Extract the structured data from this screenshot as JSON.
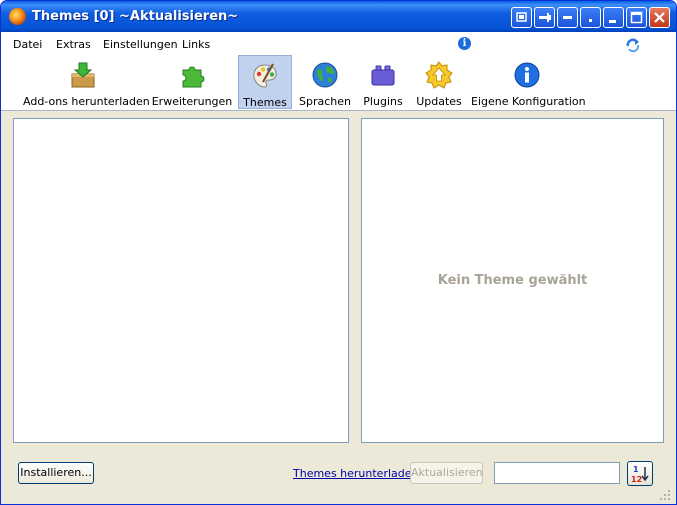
{
  "window": {
    "title": "Themes [0] ~Aktualisieren~",
    "controls": {
      "minimize": "–",
      "maximize": "□",
      "close": "×"
    }
  },
  "menu": [
    {
      "label": "Datei"
    },
    {
      "label": "Extras"
    },
    {
      "label": "Einstellungen"
    },
    {
      "label": "Links"
    }
  ],
  "toolbar": [
    {
      "label": "Add-ons herunterladen",
      "icon": "download-box-icon"
    },
    {
      "label": "Erweiterungen",
      "icon": "puzzle-piece-icon"
    },
    {
      "label": "Themes",
      "icon": "palette-icon",
      "selected": true
    },
    {
      "label": "Sprachen",
      "icon": "globe-icon"
    },
    {
      "label": "Plugins",
      "icon": "plugin-block-icon"
    },
    {
      "label": "Updates",
      "icon": "update-arrow-icon"
    },
    {
      "label": "Eigene Konfiguration",
      "icon": "info-icon"
    }
  ],
  "preview": {
    "empty_text": "Kein Theme gewählt"
  },
  "footer": {
    "install_label": "Installieren...",
    "download_link": "Themes herunterladen",
    "update_label": "Aktualisieren",
    "search_value": "",
    "sort_label": "1↓2"
  },
  "colors": {
    "titlebar": "#0653d6",
    "window_bg": "#ece9d8",
    "selected_tool": "#c1d2ee",
    "link": "#0000aa",
    "empty_text": "#a9a398"
  }
}
